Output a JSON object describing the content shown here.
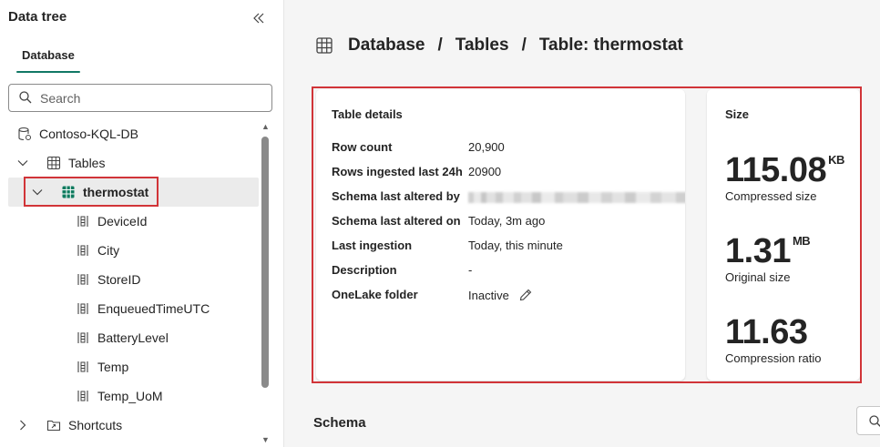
{
  "sidebar": {
    "title": "Data tree",
    "tab_label": "Database",
    "search_placeholder": "Search",
    "tree": {
      "database": "Contoso-KQL-DB",
      "tables_label": "Tables",
      "selected_table": "thermostat",
      "columns": [
        "DeviceId",
        "City",
        "StoreID",
        "EnqueuedTimeUTC",
        "BatteryLevel",
        "Temp",
        "Temp_UoM"
      ],
      "shortcuts_label": "Shortcuts"
    }
  },
  "breadcrumb": {
    "database": "Database",
    "separator": "/",
    "tables": "Tables",
    "table": "Table: thermostat"
  },
  "details": {
    "title": "Table details",
    "rows": [
      {
        "key": "Row count",
        "value": "20,900"
      },
      {
        "key": "Rows ingested last 24h",
        "value": "20900"
      },
      {
        "key": "Schema last altered by",
        "value": ""
      },
      {
        "key": "Schema last altered on",
        "value": "Today, 3m ago"
      },
      {
        "key": "Last ingestion",
        "value": "Today, this minute"
      },
      {
        "key": "Description",
        "value": "-"
      },
      {
        "key": "OneLake folder",
        "value": "Inactive"
      }
    ]
  },
  "size": {
    "title": "Size",
    "compressed": {
      "value": "115.08",
      "unit": "KB",
      "label": "Compressed size"
    },
    "original": {
      "value": "1.31",
      "unit": "MB",
      "label": "Original size"
    },
    "ratio": {
      "value": "11.63",
      "label": "Compression ratio"
    }
  },
  "schema": {
    "title": "Schema"
  },
  "colors": {
    "accent": "#117865",
    "highlight": "#d13438",
    "table_icon": "#0f7b5f"
  }
}
